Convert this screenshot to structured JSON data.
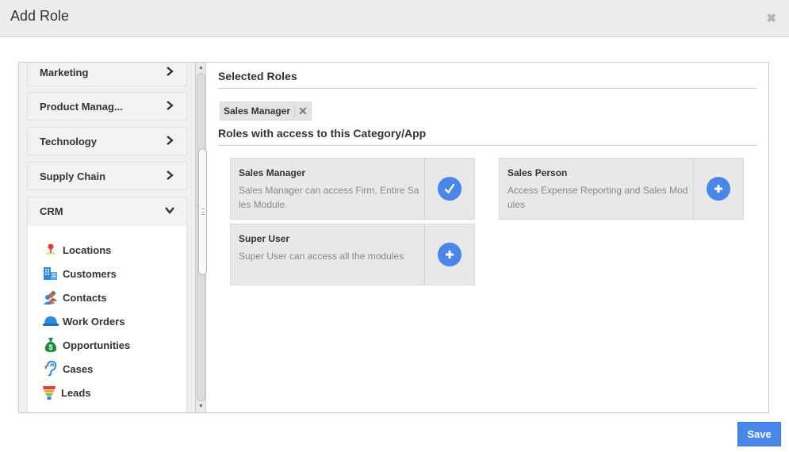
{
  "modal": {
    "title": "Add Role",
    "close_icon": "close-icon"
  },
  "sidebar": {
    "categories": [
      {
        "label": "Marketing",
        "icon": "chevron-right-icon",
        "expanded": false
      },
      {
        "label": "Product Manag...",
        "icon": "chevron-right-icon",
        "expanded": false
      },
      {
        "label": "Technology",
        "icon": "chevron-right-icon",
        "expanded": false
      },
      {
        "label": "Supply Chain",
        "icon": "chevron-right-icon",
        "expanded": false
      },
      {
        "label": "CRM",
        "icon": "chevron-down-icon",
        "expanded": true
      }
    ],
    "crm_apps": [
      {
        "label": "Locations",
        "icon": "map-pin-icon"
      },
      {
        "label": "Customers",
        "icon": "building-icon"
      },
      {
        "label": "Contacts",
        "icon": "people-icon"
      },
      {
        "label": "Work Orders",
        "icon": "hard-hat-icon"
      },
      {
        "label": "Opportunities",
        "icon": "money-bag-icon"
      },
      {
        "label": "Cases",
        "icon": "ear-icon"
      },
      {
        "label": "Leads",
        "icon": "funnel-icon"
      }
    ]
  },
  "main": {
    "selected_title": "Selected Roles",
    "selected_tags": [
      {
        "label": "Sales Manager",
        "remove_icon": "remove-icon"
      }
    ],
    "access_title": "Roles with access to this Category/App",
    "roles": [
      {
        "name": "Sales Manager",
        "description": "Sales Manager can access Firm, Entire Sales Module.",
        "selected": true,
        "action_icon": "check-icon"
      },
      {
        "name": "Sales Person",
        "description": "Access Expense Reporting and Sales Modules",
        "selected": false,
        "action_icon": "plus-icon"
      },
      {
        "name": "Super User",
        "description": "Super User can access all the modules",
        "selected": false,
        "action_icon": "plus-icon"
      }
    ]
  },
  "footer": {
    "save_label": "Save"
  },
  "colors": {
    "accent": "#4a86e8",
    "header_bg": "#ececec",
    "card_bg": "#e8e8e8"
  }
}
